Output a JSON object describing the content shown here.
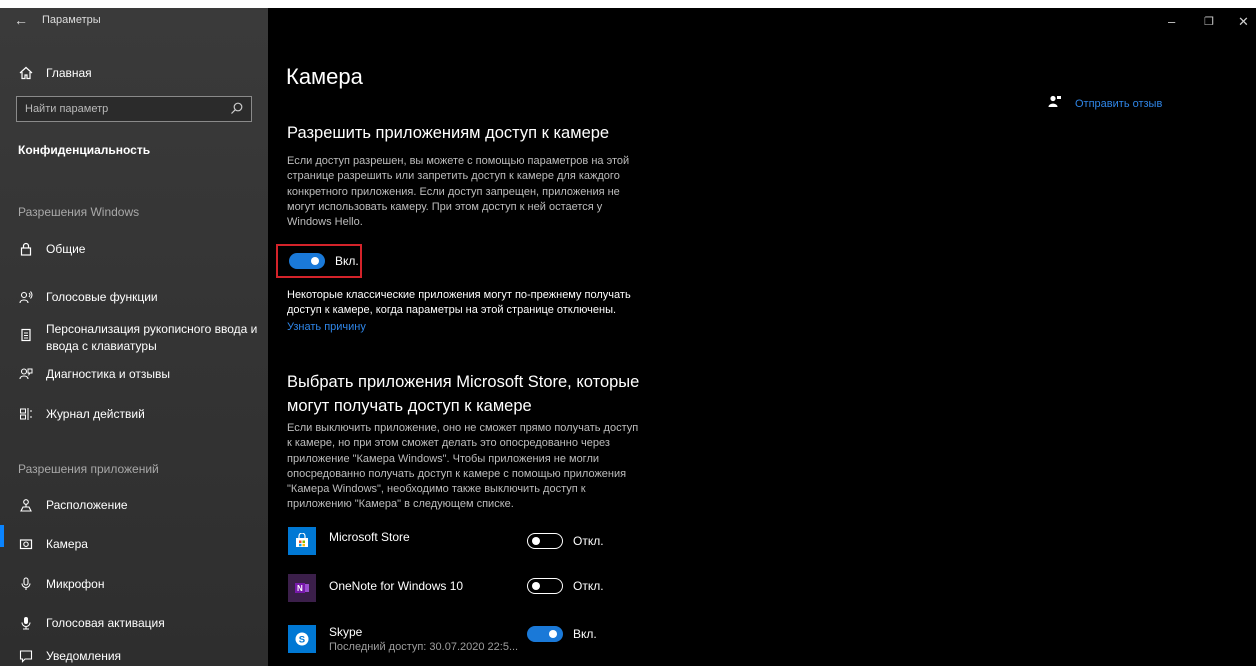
{
  "window": {
    "title": "Параметры",
    "controls": {
      "minimize": "–",
      "restore": "❐",
      "close": "✕"
    }
  },
  "sidebar": {
    "home_label": "Главная",
    "search_placeholder": "Найти параметр",
    "category": "Конфиденциальность",
    "section_windows": "Разрешения Windows",
    "windows_items": [
      {
        "label": "Общие",
        "icon": "lock-icon"
      },
      {
        "label": "Голосовые функции",
        "icon": "voice-icon"
      },
      {
        "label_line1": "Персонализация рукописного ввода и",
        "label_line2": "ввода с клавиатуры",
        "icon": "inking-icon"
      },
      {
        "label": "Диагностика и отзывы",
        "icon": "feedback-icon"
      },
      {
        "label": "Журнал действий",
        "icon": "timeline-icon"
      }
    ],
    "section_apps": "Разрешения приложений",
    "apps_items": [
      {
        "label": "Расположение",
        "icon": "location-icon"
      },
      {
        "label": "Камера",
        "icon": "camera-icon",
        "selected": true
      },
      {
        "label": "Микрофон",
        "icon": "microphone-icon"
      },
      {
        "label": "Голосовая активация",
        "icon": "voice-activation-icon"
      },
      {
        "label": "Уведомления",
        "icon": "notification-icon"
      }
    ]
  },
  "main": {
    "title": "Камера",
    "feedback_label": "Отправить отзыв",
    "section1": {
      "heading": "Разрешить приложениям доступ к камере",
      "description": [
        "Если доступ разрешен, вы можете с помощью параметров на этой",
        "странице разрешить или запретить доступ к камере для каждого",
        "конкретного приложения. Если доступ запрещен, приложения не",
        "могут использовать камеру. При этом доступ к ней остается у",
        "Windows Hello."
      ],
      "toggle_label": "Вкл.",
      "toggle_on": true,
      "note": [
        "Некоторые классические приложения могут по-прежнему получать",
        "доступ к камере, когда параметры на этой странице отключены."
      ],
      "link": "Узнать причину"
    },
    "section2": {
      "heading_line1": "Выбрать приложения Microsoft Store, которые",
      "heading_line2": "могут получать доступ к камере",
      "description": [
        "Если выключить приложение, оно не сможет прямо получать доступ",
        "к камере, но при этом сможет делать это опосредованно через",
        "приложение \"Камера Windows\". Чтобы приложения не могли",
        "опосредованно получать доступ к камере с помощью приложения",
        "\"Камера Windows\", необходимо также выключить доступ к",
        "приложению \"Камера\" в следующем списке."
      ],
      "apps": [
        {
          "name": "Microsoft Store",
          "status": "Откл.",
          "on": false,
          "icon": "store-icon",
          "color": "#0078d4"
        },
        {
          "name": "OneNote for Windows 10",
          "status": "Откл.",
          "on": false,
          "icon": "onenote-icon",
          "color": "#7719aa"
        },
        {
          "name": "Skype",
          "sub": "Последний доступ: 30.07.2020 22:5...",
          "status": "Вкл.",
          "on": true,
          "icon": "skype-icon",
          "color": "#0078d4"
        }
      ]
    }
  }
}
